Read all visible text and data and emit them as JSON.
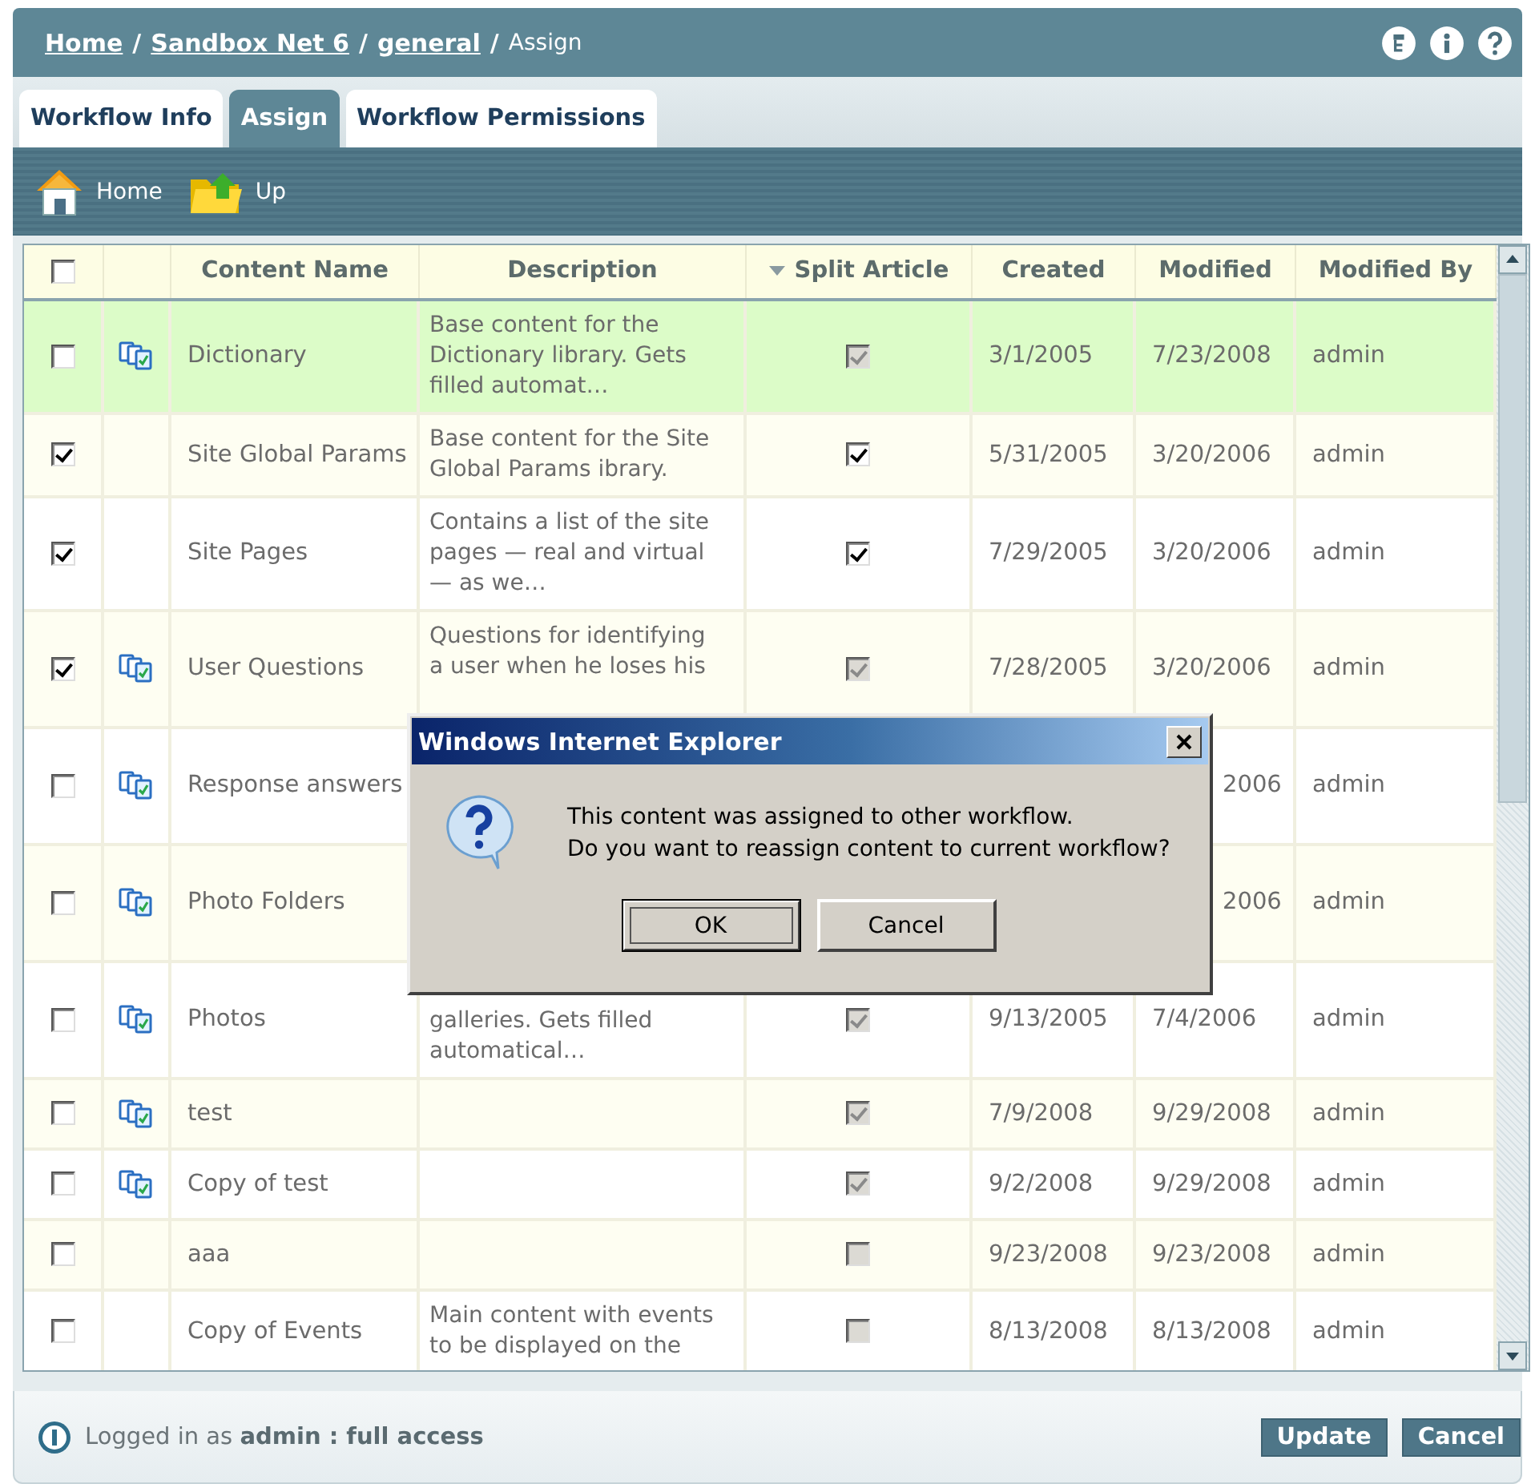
{
  "breadcrumb": [
    {
      "label": "Home",
      "link": true
    },
    {
      "label": "Sandbox Net 6",
      "link": true,
      "separator": "/"
    },
    {
      "label": "general",
      "link": true,
      "separator": "/"
    },
    {
      "label": "Assign",
      "link": false,
      "separator": "/"
    }
  ],
  "header_icons": [
    {
      "kind": "sitemap"
    },
    {
      "kind": "info"
    },
    {
      "kind": "help"
    }
  ],
  "tabs": [
    {
      "label": "Workflow Info",
      "selected": false
    },
    {
      "label": "Assign",
      "selected": true
    },
    {
      "label": "Workflow Permissions",
      "selected": false
    }
  ],
  "toolbar": [
    {
      "label": "Home",
      "kind": "home"
    },
    {
      "label": "Up",
      "kind": "up"
    }
  ],
  "table": {
    "select_all": {
      "checked": false
    },
    "columns": [
      {
        "label": "Content Name",
        "sorted": false
      },
      {
        "label": "Description",
        "sorted": false
      },
      {
        "label": "Split Article",
        "sorted": true
      },
      {
        "label": "Created",
        "sorted": false
      },
      {
        "label": "Modified",
        "sorted": false
      },
      {
        "label": "Modified By",
        "sorted": false
      }
    ],
    "rows": [
      {
        "kind": "regular",
        "highlighted": true,
        "checked": false,
        "workflow_icon": true,
        "name": "Dictionary",
        "description": [
          "Base content for the",
          "Dictionary library. Gets",
          "filled automat…"
        ],
        "split": {
          "checked": true,
          "disabled": true
        },
        "created": "3/1/2005",
        "modified": "7/23/2008",
        "modified_by": "admin"
      },
      {
        "kind": "regular",
        "highlighted": false,
        "checked": true,
        "workflow_icon": false,
        "name": "Site Global Params",
        "description": [
          "Base content for the Site",
          "Global Params ibrary."
        ],
        "split": {
          "checked": true,
          "disabled": false
        },
        "created": "5/31/2005",
        "modified": "3/20/2006",
        "modified_by": "admin"
      },
      {
        "kind": "regular",
        "highlighted": false,
        "checked": true,
        "workflow_icon": false,
        "name": "Site Pages",
        "description": [
          "Contains a list of the site",
          "pages — real and virtual",
          "— as we…"
        ],
        "split": {
          "checked": true,
          "disabled": false
        },
        "created": "7/29/2005",
        "modified": "3/20/2006",
        "modified_by": "admin"
      },
      {
        "kind": "tall",
        "highlighted": false,
        "checked": true,
        "workflow_icon": true,
        "name": "User Questions",
        "description": [
          "Questions for identifying",
          "a user when he loses his"
        ],
        "split": {
          "checked": true,
          "disabled": true
        },
        "created": "7/28/2005",
        "modified": "3/20/2006",
        "modified_by": "admin"
      },
      {
        "kind": "tall",
        "highlighted": false,
        "checked": false,
        "workflow_icon": true,
        "name": "Response answers",
        "description": [],
        "modified": "2006",
        "modified_by": "admin",
        "modified_cut": true
      },
      {
        "kind": "tall",
        "highlighted": false,
        "checked": false,
        "workflow_icon": true,
        "name": "Photo Folders",
        "description": [],
        "modified": "2006",
        "modified_by": "admin",
        "modified_cut": true
      },
      {
        "kind": "lowered",
        "highlighted": false,
        "checked": false,
        "workflow_icon": true,
        "name": "Photos",
        "description": [
          "galleries. Gets filled",
          "automatical…"
        ],
        "split": {
          "checked": true,
          "disabled": true
        },
        "created": "9/13/2005",
        "modified": "7/4/2006",
        "modified_by": "admin"
      },
      {
        "kind": "regular",
        "highlighted": false,
        "checked": false,
        "workflow_icon": true,
        "name": "test",
        "description": [],
        "split": {
          "checked": true,
          "disabled": true
        },
        "created": "7/9/2008",
        "modified": "9/29/2008",
        "modified_by": "admin"
      },
      {
        "kind": "regular",
        "highlighted": false,
        "checked": false,
        "workflow_icon": true,
        "name": "Copy of test",
        "description": [],
        "split": {
          "checked": true,
          "disabled": true
        },
        "created": "9/2/2008",
        "modified": "9/29/2008",
        "modified_by": "admin"
      },
      {
        "kind": "regular",
        "highlighted": false,
        "checked": false,
        "workflow_icon": false,
        "name": "aaa",
        "description": [],
        "split": {
          "checked": false,
          "disabled": true
        },
        "created": "9/23/2008",
        "modified": "9/23/2008",
        "modified_by": "admin"
      },
      {
        "kind": "regular",
        "highlighted": false,
        "checked": false,
        "workflow_icon": false,
        "name": "Copy of Events",
        "description": [
          "Main content with events",
          "to be displayed on the"
        ],
        "split": {
          "checked": false,
          "disabled": true
        },
        "created": "8/13/2008",
        "modified": "8/13/2008",
        "modified_by": "admin"
      }
    ]
  },
  "dialog": {
    "title": "Windows Internet Explorer",
    "message": [
      "This content was assigned to other workflow.",
      "Do you want to reassign content to current workflow?"
    ],
    "buttons": [
      {
        "label": "OK",
        "focused": true
      },
      {
        "label": "Cancel",
        "focused": false
      }
    ]
  },
  "footer": {
    "status": "Logged in as **admin : full access**",
    "buttons": [
      "Update",
      "Cancel"
    ]
  }
}
